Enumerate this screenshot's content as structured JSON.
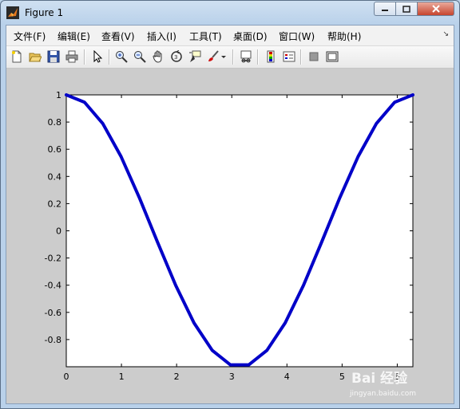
{
  "window": {
    "title": "Figure 1",
    "controls": [
      "minimize",
      "maximize",
      "close"
    ]
  },
  "menubar": {
    "items": [
      {
        "label": "文件(F)"
      },
      {
        "label": "编辑(E)"
      },
      {
        "label": "查看(V)"
      },
      {
        "label": "插入(I)"
      },
      {
        "label": "工具(T)"
      },
      {
        "label": "桌面(D)"
      },
      {
        "label": "窗口(W)"
      },
      {
        "label": "帮助(H)"
      }
    ]
  },
  "toolbar": {
    "buttons": [
      "new-figure-icon",
      "open-file-icon",
      "save-icon",
      "print-icon",
      "edit-plot-arrow-icon",
      "zoom-in-icon",
      "zoom-out-icon",
      "pan-hand-icon",
      "rotate-3d-icon",
      "data-cursor-icon",
      "brush-icon",
      "brush-dropdown-icon",
      "link-plot-icon",
      "insert-colorbar-icon",
      "insert-legend-icon",
      "hide-plot-tools-icon",
      "show-plot-tools-icon"
    ]
  },
  "colors": {
    "line": "#0000c8",
    "figure_bg": "#cccccc",
    "axes_bg": "#ffffff"
  },
  "chart_data": {
    "type": "line",
    "function": "cos(x)",
    "title": "",
    "xlabel": "",
    "ylabel": "",
    "xlim": [
      0,
      6.2832
    ],
    "ylim": [
      -1,
      1
    ],
    "xticks": [
      0,
      1,
      2,
      3,
      4,
      5,
      6
    ],
    "xtick_labels": [
      "0",
      "1",
      "2",
      "3",
      "4",
      "5",
      "6"
    ],
    "yticks": [
      1,
      0.8,
      0.6,
      0.4,
      0.2,
      0,
      -0.2,
      -0.4,
      -0.6,
      -0.8
    ],
    "ytick_labels": [
      "1",
      "0.8",
      "0.6",
      "0.4",
      "0.2",
      "0",
      "-0.2",
      "-0.4",
      "-0.6",
      "-0.8"
    ],
    "grid": false,
    "series": [
      {
        "x": [
          0,
          0.3307,
          0.6614,
          0.9921,
          1.3228,
          1.6535,
          1.9842,
          2.3149,
          2.6456,
          2.9762,
          3.3069,
          3.6376,
          3.9683,
          4.299,
          4.6297,
          4.9604,
          5.2911,
          5.6218,
          5.9525,
          6.2832
        ],
        "y": [
          1,
          0.9458,
          0.7891,
          0.5469,
          0.2455,
          -0.0826,
          -0.4017,
          -0.6773,
          -0.8795,
          -0.9864,
          -0.9864,
          -0.8795,
          -0.6773,
          -0.4017,
          -0.0826,
          0.2455,
          0.5469,
          0.7891,
          0.9458,
          1
        ]
      }
    ]
  },
  "watermark": {
    "brand": "Bai 经验",
    "url": "jingyan.baidu.com"
  }
}
